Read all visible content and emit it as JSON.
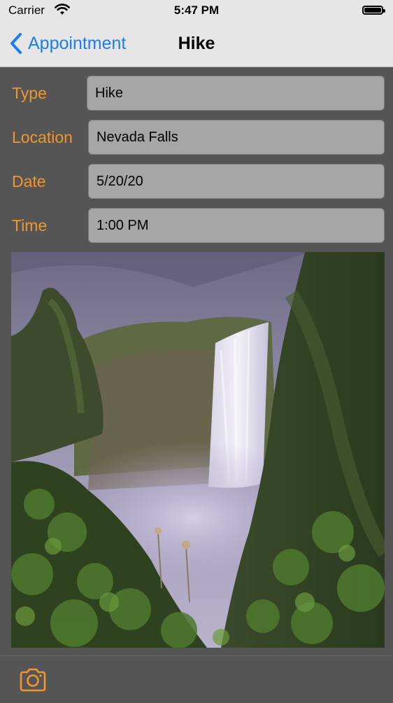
{
  "status_bar": {
    "carrier": "Carrier",
    "time": "5:47 PM"
  },
  "nav": {
    "back_label": "Appointment",
    "title": "Hike"
  },
  "form": {
    "fields": [
      {
        "label": "Type",
        "value": "Hike"
      },
      {
        "label": "Location",
        "value": "Nevada Falls"
      },
      {
        "label": "Date",
        "value": "5/20/20"
      },
      {
        "label": "Time",
        "value": "1:00 PM"
      }
    ]
  },
  "photo": {
    "subject": "waterfall-photo"
  },
  "toolbar": {
    "camera_icon": "camera-icon"
  },
  "colors": {
    "accent_tint": "#1a7ef5",
    "label_orange": "#f0962c",
    "field_background": "#a6a6a6",
    "content_background": "#555555",
    "bar_background": "#e6e6e6"
  }
}
